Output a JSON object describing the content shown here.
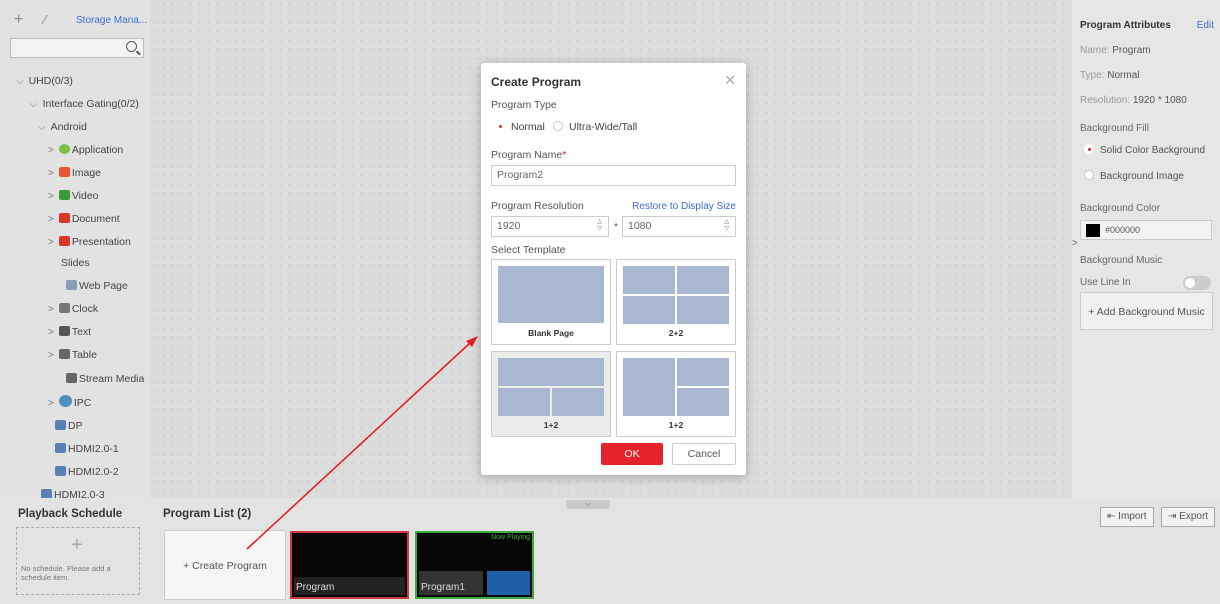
{
  "toolbar": {
    "add_icon": "plus-icon",
    "edit_icon": "pencil-icon",
    "storage_label": "Storage Mana..."
  },
  "tree": {
    "root": "UHD(0/3)",
    "group": "Interface Gating(0/2)",
    "android": "Android",
    "items": [
      {
        "label": "Application",
        "icon": "application-icon",
        "color": "#7bc043"
      },
      {
        "label": "Image",
        "icon": "image-icon",
        "color": "#e8563a"
      },
      {
        "label": "Video",
        "icon": "video-icon",
        "color": "#3a9a3a"
      },
      {
        "label": "Document",
        "icon": "document-icon",
        "color": "#d9372b"
      },
      {
        "label": "Presentation",
        "icon": "presentation-icon",
        "color": "#d9372b"
      },
      {
        "label": "Slides",
        "icon": "",
        "color": ""
      },
      {
        "label": "Web Page",
        "icon": "web-page-icon",
        "color": "#8a9db8"
      },
      {
        "label": "Clock",
        "icon": "clock-icon",
        "color": "#777777"
      },
      {
        "label": "Text",
        "icon": "text-icon",
        "color": "#555555"
      },
      {
        "label": "Table",
        "icon": "table-icon",
        "color": "#666666"
      },
      {
        "label": "Stream Media",
        "icon": "stream-media-icon",
        "color": "#666666"
      },
      {
        "label": "IPC",
        "icon": "ipc-camera-icon",
        "color": "#4f8ec0"
      },
      {
        "label": "DP",
        "icon": "dp-icon",
        "color": "#5a7fb5"
      },
      {
        "label": "HDMI2.0-1",
        "icon": "hdmi-icon",
        "color": "#5a7fb5"
      },
      {
        "label": "HDMI2.0-2",
        "icon": "hdmi-icon",
        "color": "#5a7fb5"
      },
      {
        "label": "HDMI2.0-3",
        "icon": "hdmi-icon",
        "color": "#5a7fb5"
      }
    ]
  },
  "attributes": {
    "title": "Program Attributes",
    "edit": "Edit",
    "name_label": "Name:",
    "name_value": "Program",
    "type_label": "Type:",
    "type_value": "Normal",
    "resolution_label": "Resolution:",
    "resolution_value": "1920 * 1080",
    "bg_fill_label": "Background Fill",
    "fill_solid": "Solid Color Background",
    "fill_image": "Background Image",
    "bg_color_label": "Background Color",
    "bg_color_value": "#000000",
    "bg_music_label": "Background Music",
    "use_line_in": "Use Line In",
    "add_music": "+ Add Background Music"
  },
  "schedule": {
    "title": "Playback Schedule",
    "empty_text": "No schedule. Please add a schedule item."
  },
  "program_list": {
    "title": "Program List (2)",
    "create_label": "+ Create Program",
    "programs": [
      {
        "label": "Program",
        "status": "",
        "border": "#d13a3a"
      },
      {
        "label": "Program1",
        "status": "Now Playing",
        "border": "#3ea83e"
      }
    ],
    "import": "Import",
    "export": "Export"
  },
  "modal": {
    "title": "Create Program",
    "program_type_label": "Program Type",
    "type_normal": "Normal",
    "type_ultra": "Ultra-Wide/Tall",
    "program_name_label": "Program Name",
    "required_mark": "*",
    "program_name_value": "Program2",
    "resolution_label": "Program Resolution",
    "restore_link": "Restore to Display Size",
    "width": "1920",
    "height": "1080",
    "times": "*",
    "select_template_label": "Select Template",
    "templates": [
      "Blank Page",
      "2+2",
      "1+2",
      "1+2"
    ],
    "ok": "OK",
    "cancel": "Cancel"
  },
  "colors": {
    "accent": "#e4232c",
    "link": "#3b6dd8",
    "arrow": "#e02020"
  }
}
